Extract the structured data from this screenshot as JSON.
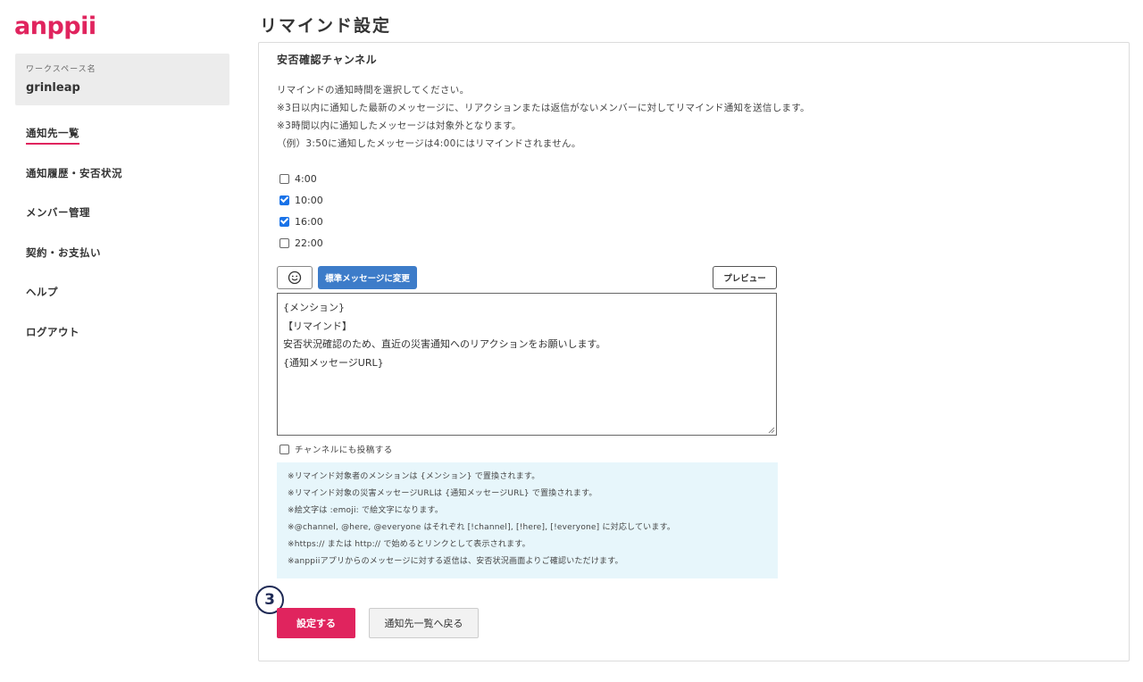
{
  "sidebar": {
    "logo": "anppii",
    "workspace_label": "ワークスペース名",
    "workspace_name": "grinleap",
    "items": [
      {
        "label": "通知先一覧",
        "active": true
      },
      {
        "label": "通知履歴・安否状況",
        "active": false
      },
      {
        "label": "メンバー管理",
        "active": false
      },
      {
        "label": "契約・お支払い",
        "active": false
      },
      {
        "label": "ヘルプ",
        "active": false
      },
      {
        "label": "ログアウト",
        "active": false
      }
    ]
  },
  "page": {
    "title": "リマインド設定"
  },
  "panel": {
    "section_title": "安否確認チャンネル",
    "description": [
      "リマインドの通知時間を選択してください。",
      "※3日以内に通知した最新のメッセージに、リアクションまたは返信がないメンバーに対してリマインド通知を送信します。",
      "※3時間以内に通知したメッセージは対象外となります。",
      "（例）3:50に通知したメッセージは4:00にはリマインドされません。"
    ],
    "times": [
      {
        "label": "4:00",
        "checked": false
      },
      {
        "label": "10:00",
        "checked": true
      },
      {
        "label": "16:00",
        "checked": true
      },
      {
        "label": "22:00",
        "checked": false
      }
    ],
    "toolbar": {
      "emoji_icon": "smiley-icon",
      "standard_button": "標準メッセージに変更",
      "preview_button": "プレビュー"
    },
    "message_lines": [
      "{メンション}",
      "【リマインド】",
      "安否状況確認のため、直近の災害通知へのリアクションをお願いします。",
      "{通知メッセージURL}"
    ],
    "post_to_channel_label": "チャンネルにも投稿する",
    "post_to_channel_checked": false,
    "info_lines": [
      "※リマインド対象者のメンションは {メンション} で置換されます。",
      "※リマインド対象の災害メッセージURLは {通知メッセージURL} で置換されます。",
      "※絵文字は :emoji: で絵文字になります。",
      "※@channel, @here, @everyone はそれぞれ [!channel], [!here], [!everyone] に対応しています。",
      "※https:// または http:// で始めるとリンクとして表示されます。",
      "※anppiiアプリからのメッセージに対する返信は、安否状況画面よりご確認いただけます。"
    ]
  },
  "actions": {
    "step_number": "3",
    "save_button": "設定する",
    "back_button": "通知先一覧へ戻る"
  },
  "colors": {
    "brand": "#e0245e",
    "info_bg": "#e7f6fb",
    "standard_button": "#3d7cc9",
    "step_badge": "#1f2a55"
  }
}
